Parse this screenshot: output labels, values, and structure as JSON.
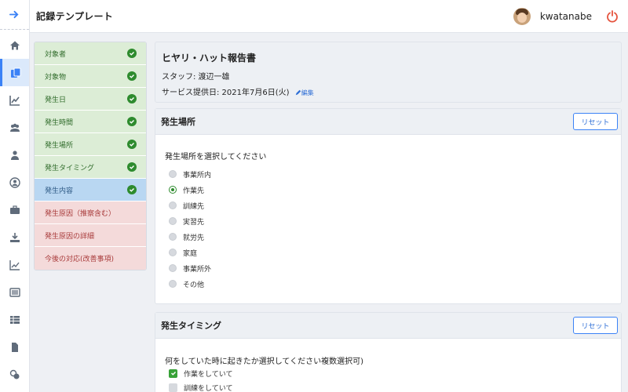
{
  "header": {
    "title": "記録テンプレート",
    "username": "kwatanabe"
  },
  "rail": {
    "icons": [
      "arrow-right-icon",
      "home-icon",
      "copy-icon",
      "edit-chart-icon",
      "users-icon",
      "user-icon",
      "user-circle-icon",
      "briefcase-icon",
      "download-icon",
      "line-chart-icon",
      "list-icon",
      "table-icon",
      "file-icon",
      "coins-icon"
    ],
    "active_index": 2
  },
  "steps": [
    {
      "label": "対象者",
      "status": "done"
    },
    {
      "label": "対象物",
      "status": "done"
    },
    {
      "label": "発生日",
      "status": "done"
    },
    {
      "label": "発生時間",
      "status": "done"
    },
    {
      "label": "発生場所",
      "status": "done"
    },
    {
      "label": "発生タイミング",
      "status": "done"
    },
    {
      "label": "発生内容",
      "status": "current"
    },
    {
      "label": "発生原因（推察含む）",
      "status": "todo"
    },
    {
      "label": "発生原因の詳細",
      "status": "todo"
    },
    {
      "label": "今後の対応(改善事項)",
      "status": "todo"
    }
  ],
  "report": {
    "title": "ヒヤリ・ハット報告書",
    "staff": "スタッフ: 渡辺一雄",
    "service_date": "サービス提供日: 2021年7月6日(火)",
    "edit_label": "編集"
  },
  "location": {
    "heading": "発生場所",
    "reset_label": "リセット",
    "question": "発生場所を選択してください",
    "options": [
      "事業所内",
      "作業先",
      "訓練先",
      "実習先",
      "就労先",
      "家庭",
      "事業所外",
      "その他"
    ],
    "selected": "作業先"
  },
  "timing": {
    "heading": "発生タイミング",
    "reset_label": "リセット",
    "question": "何をしていた時に起きたか選択してください複数選択可)",
    "options": [
      {
        "label": "作業をしていて",
        "checked": true
      },
      {
        "label": "訓練をしていて",
        "checked": false
      }
    ]
  },
  "colors": {
    "done_bg": "#dcedd6",
    "current_bg": "#b9d7f2",
    "todo_bg": "#f4dada",
    "accent": "#3b82f6",
    "check": "#2e8b2e",
    "power": "#e5533d"
  }
}
